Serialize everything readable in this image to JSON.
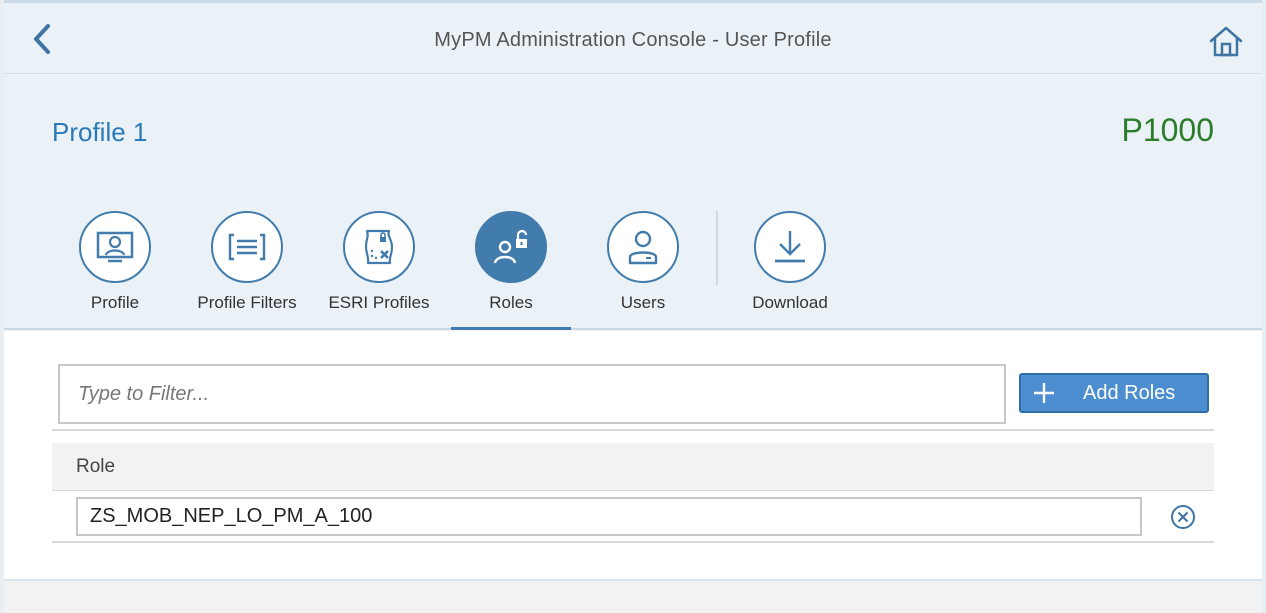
{
  "header": {
    "title": "MyPM Administration Console - User Profile",
    "back_icon": "chevron-left-icon",
    "home_icon": "home-icon"
  },
  "object": {
    "title": "Profile 1",
    "number": "P1000",
    "title_color": "#2b7ab8",
    "number_color": "#2b7d2b"
  },
  "tabs": [
    {
      "label": "Profile",
      "icon": "profile-display-icon",
      "active": false
    },
    {
      "label": "Profile Filters",
      "icon": "filter-list-icon",
      "active": false
    },
    {
      "label": "ESRI Profiles",
      "icon": "map-delete-icon",
      "active": false
    },
    {
      "label": "Roles",
      "icon": "role-lock-icon",
      "active": true
    },
    {
      "label": "Users",
      "icon": "user-icon",
      "active": false
    },
    {
      "label": "Download",
      "icon": "download-icon",
      "active": false
    }
  ],
  "filter": {
    "placeholder": "Type to Filter...",
    "value": ""
  },
  "add_button": {
    "label": "Add Roles",
    "icon": "add-icon"
  },
  "table": {
    "columns": [
      "Role"
    ],
    "rows": [
      {
        "role": "ZS_MOB_NEP_LO_PM_A_100",
        "delete_icon": "circle-close-icon"
      }
    ]
  },
  "colors": {
    "accent": "#427cac",
    "button": "#4c8ed0",
    "header_bg": "#eaf1f7"
  }
}
